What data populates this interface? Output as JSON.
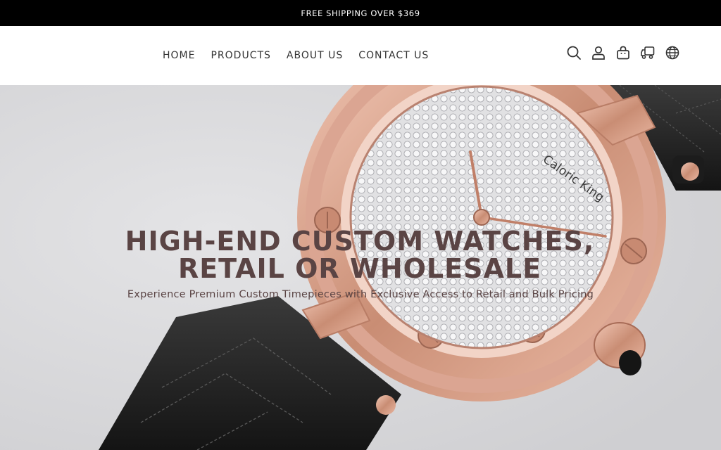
{
  "announcement": {
    "text": "FREE SHIPPING OVER $369"
  },
  "nav": {
    "items": [
      {
        "label": "HOME"
      },
      {
        "label": "PRODUCTS"
      },
      {
        "label": "ABOUT US"
      },
      {
        "label": "CONTACT US"
      }
    ]
  },
  "header_icons": [
    "search-icon",
    "account-icon",
    "cart-icon",
    "shipping-icon",
    "language-icon"
  ],
  "hero": {
    "title_line1": "HIGH-END CUSTOM WATCHES,",
    "title_line2": "RETAIL OR WHOLESALE",
    "subtitle": "Experience Premium Custom Timepieces with Exclusive Access to Retail and Bulk Pricing",
    "watch_brand": "Caloric King",
    "colors": {
      "title": "#5a4444",
      "rose_gold": "#d49a84",
      "strap": "#1f1f1f"
    }
  }
}
